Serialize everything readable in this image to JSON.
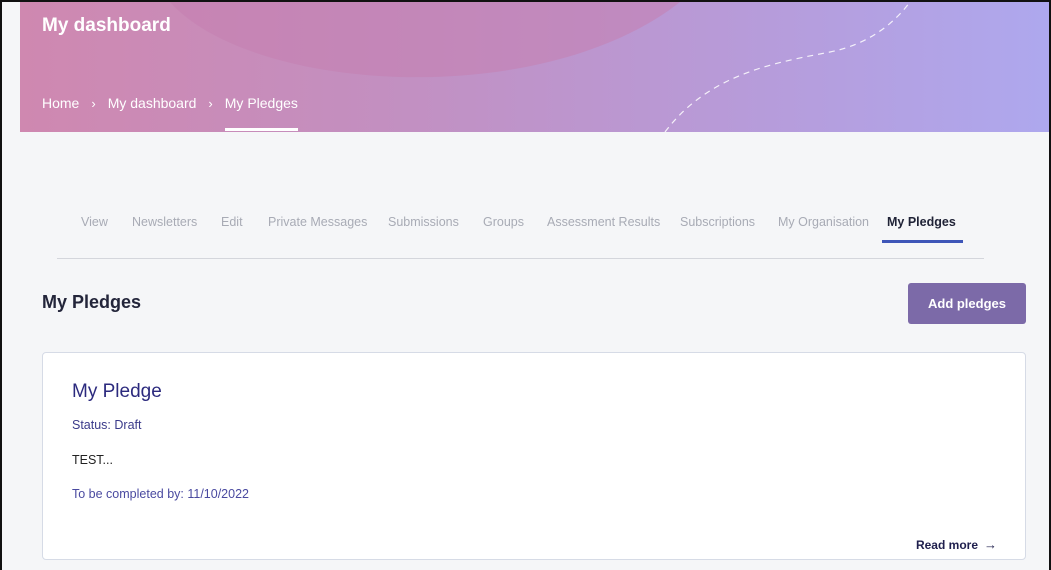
{
  "header": {
    "title": "My dashboard",
    "breadcrumb": [
      {
        "label": "Home"
      },
      {
        "label": "My dashboard"
      },
      {
        "label": "My Pledges"
      }
    ],
    "separator": "›"
  },
  "tabs": [
    {
      "label": "View"
    },
    {
      "label": "Newsletters"
    },
    {
      "label": "Edit"
    },
    {
      "label": "Private Messages"
    },
    {
      "label": "Submissions"
    },
    {
      "label": "Groups"
    },
    {
      "label": "Assessment Results"
    },
    {
      "label": "Subscriptions"
    },
    {
      "label": "My Organisation"
    },
    {
      "label": "My Pledges",
      "active": true
    }
  ],
  "section": {
    "title": "My Pledges",
    "add_button_label": "Add pledges"
  },
  "pledges": [
    {
      "title": "My Pledge",
      "status": "Status: Draft",
      "body": "TEST...",
      "due": "To be completed by: 11/10/2022",
      "read_more": "Read more",
      "read_more_icon": "arrow-right-icon"
    }
  ],
  "colors": {
    "accent": "#7c6aa8",
    "tab_active_underline": "#3e56b8",
    "title_text": "#2c2a7e"
  }
}
